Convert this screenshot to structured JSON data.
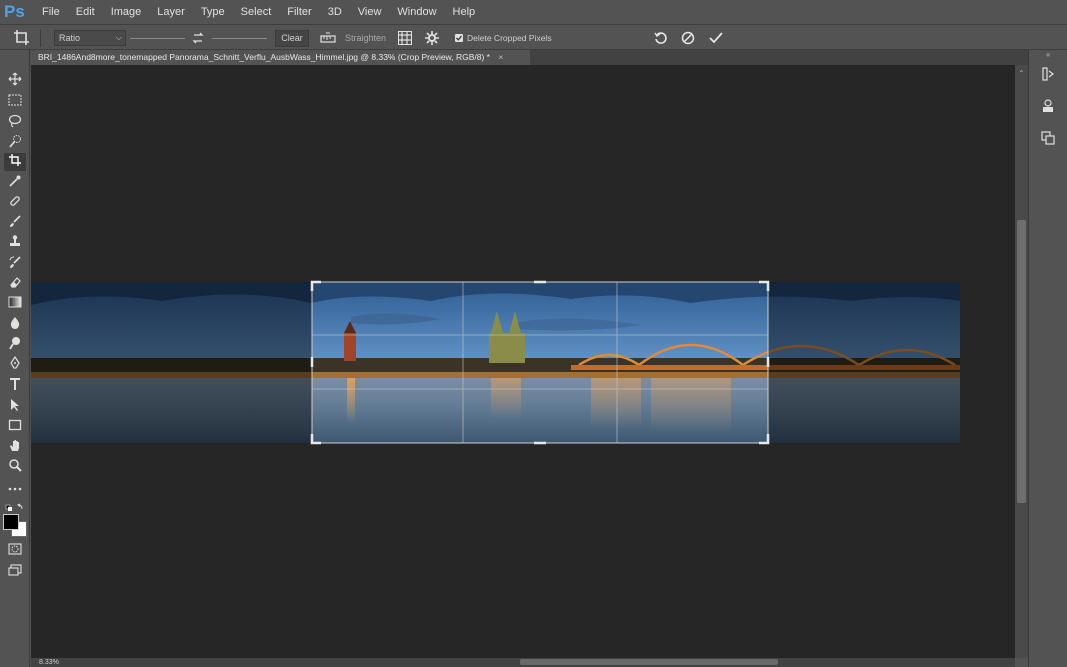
{
  "app": {
    "logo": "Ps"
  },
  "menu": [
    "File",
    "Edit",
    "Image",
    "Layer",
    "Type",
    "Select",
    "Filter",
    "3D",
    "View",
    "Window",
    "Help"
  ],
  "options": {
    "ratio_value": "Ratio",
    "clear_label": "Clear",
    "straighten_label": "Straighten",
    "delete_cropped_label": "Delete Cropped Pixels",
    "delete_cropped_checked": true
  },
  "document": {
    "tab_title": "BRI_1486And8more_tonemapped Panorama_Schnitt_Verflu_AusbWass_Himmel.jpg @ 8.33% (Crop Preview, RGB/8) *",
    "close_glyph": "×"
  },
  "status": {
    "zoom": "8.33%"
  },
  "colors": {
    "accent": "#4ea2e8",
    "canvas_bg": "#262626",
    "ui_bg": "#535353"
  }
}
